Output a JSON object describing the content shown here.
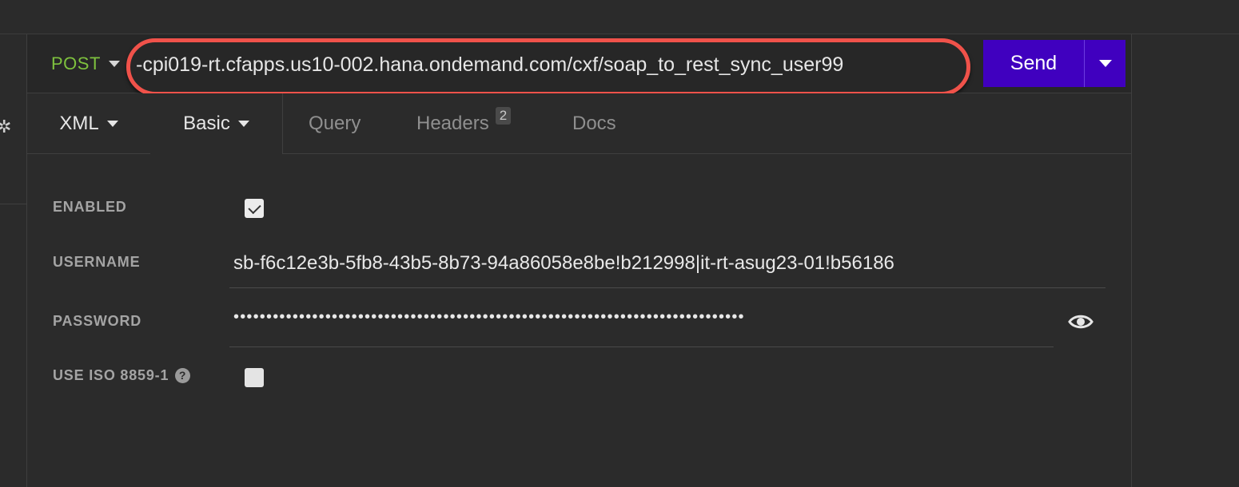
{
  "request": {
    "method": "POST",
    "url": "-cpi019-rt.cfapps.us10-002.hana.ondemand.com/cxf/soap_to_rest_sync_user99",
    "send_label": "Send"
  },
  "tabs": [
    {
      "label": "XML",
      "dropdown": true
    },
    {
      "label": "Basic",
      "dropdown": true,
      "active": true
    },
    {
      "label": "Query"
    },
    {
      "label": "Headers",
      "badge": "2"
    },
    {
      "label": "Docs"
    }
  ],
  "auth": {
    "enabled_label": "ENABLED",
    "enabled": true,
    "username_label": "USERNAME",
    "username": "sb-f6c12e3b-5fb8-43b5-8b73-94a86058e8be!b212998|it-rt-asug23-01!b56186",
    "password_label": "PASSWORD",
    "password_masked": "••••••••••••••••••••••••••••••••••••••••••••••••••••••••••••••••••••••••••••••",
    "iso_label": "USE ISO 8859-1",
    "iso_help": "?",
    "iso_enabled": false
  },
  "colors": {
    "method": "#7ec13e",
    "send": "#4000bf",
    "highlight": "#f0524a"
  },
  "icons": {
    "method_dropdown": "chevron-down-icon",
    "send_dropdown": "chevron-down-icon",
    "password_reveal": "eye-icon",
    "help": "help-icon"
  }
}
